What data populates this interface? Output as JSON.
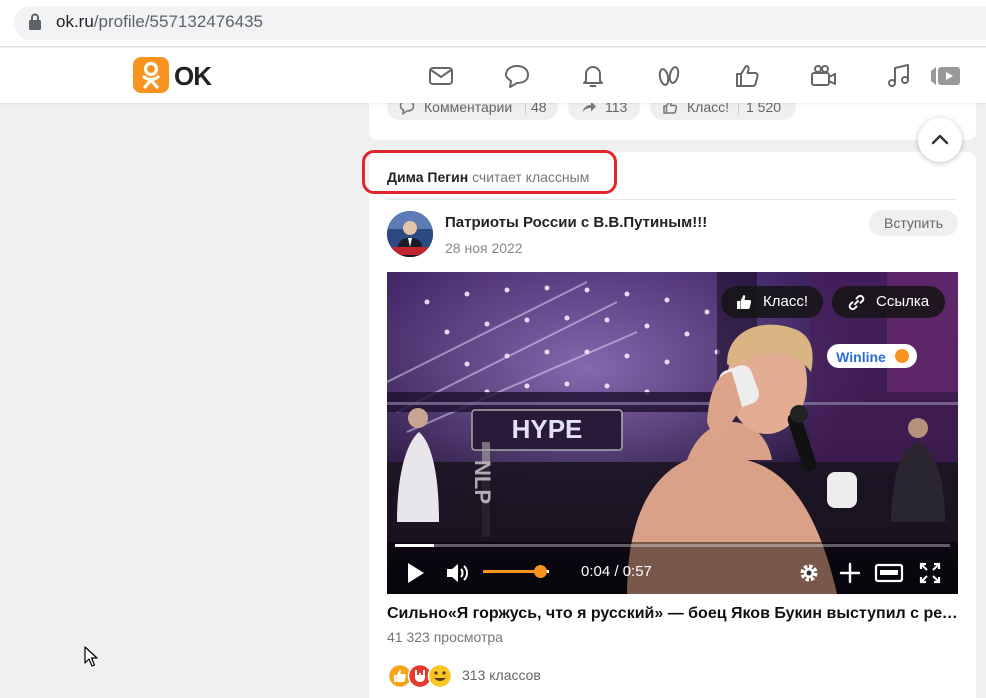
{
  "browser": {
    "url_domain": "ok.ru",
    "url_path": "/profile/557132476435"
  },
  "header": {
    "logo_text": "OK",
    "brand_color": "#f7931e",
    "nav_icons": [
      "mail-icon",
      "chat-icon",
      "bell-icon",
      "guests-icon",
      "like-icon",
      "video-icon",
      "music-icon",
      "video-play-icon"
    ]
  },
  "prev_post": {
    "comments_label": "Комментарии",
    "comments_count": "48",
    "shares_count": "113",
    "likes_label": "Класс!",
    "likes_count": "1 520"
  },
  "post": {
    "liker_name": "Дима Пегин",
    "liker_action": "считает классным",
    "group_name": "Патриоты России с В.В.Путиным!!!",
    "date": "28 ноя 2022",
    "join_label": "Вступить",
    "video": {
      "like_label": "Класс!",
      "link_label": "Ссылка",
      "time": "0:04 / 0:57",
      "progress": 0.07,
      "volume": 0.86,
      "overlay_sign": "HYPE",
      "banner": "Winline"
    },
    "title": "Сильно«Я горжусь, что я русский» — боец Яков Букин выступил с речью",
    "views": "41 323 просмотра",
    "reactions_count": "313 классов"
  }
}
